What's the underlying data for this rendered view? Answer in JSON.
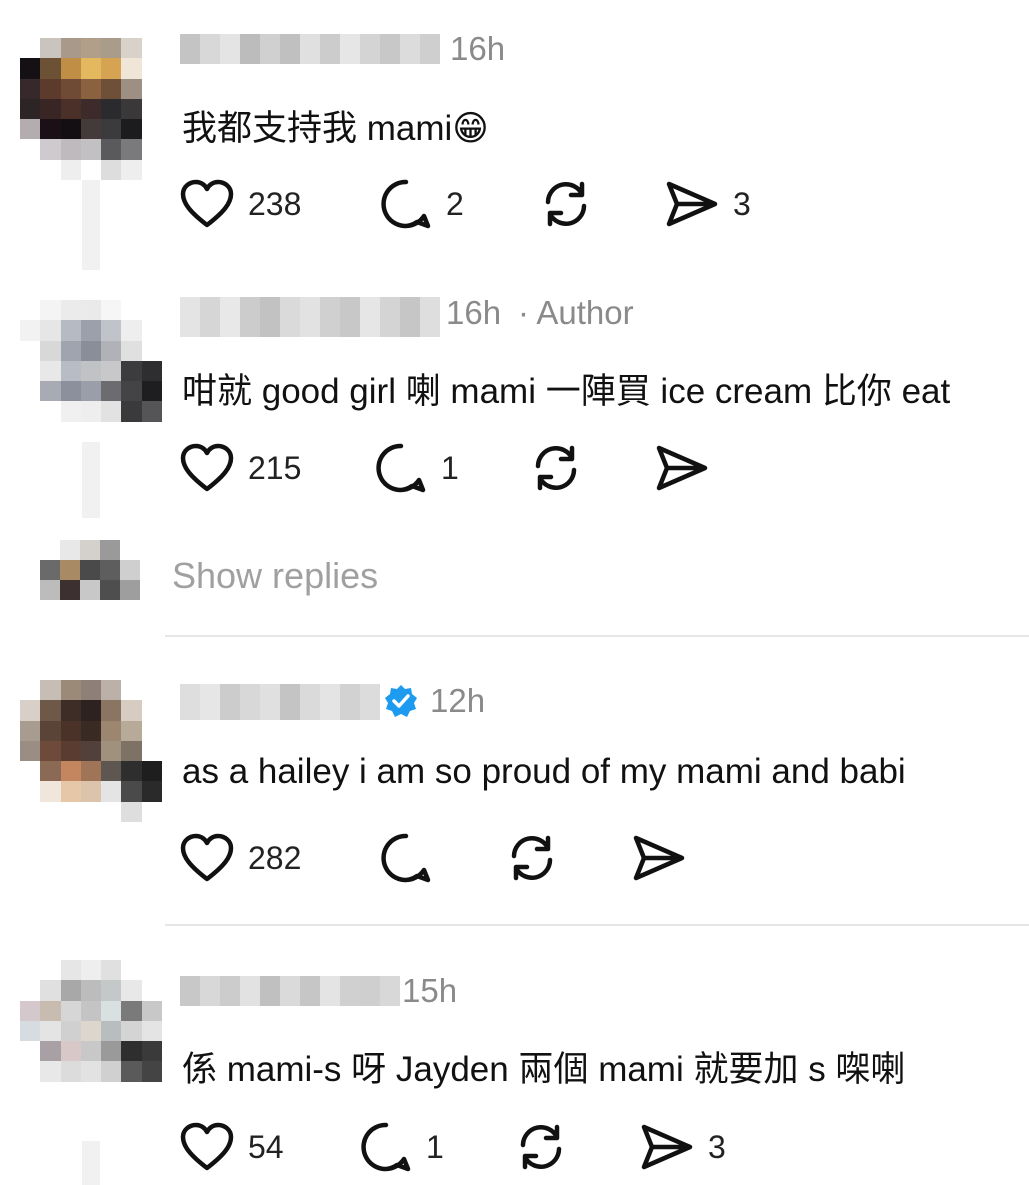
{
  "posts": [
    {
      "time": "16h",
      "author_tag": "",
      "text": "我都支持我 mami😁",
      "likes": "238",
      "replies": "2",
      "shares": "3"
    },
    {
      "time": "16h",
      "author_tag": "· Author",
      "text": "咁就 good girl 喇  mami 一陣買 ice cream 比你 eat",
      "likes": "215",
      "replies": "1",
      "shares": ""
    },
    {
      "time": "12h",
      "author_tag": "",
      "text": "as a hailey i am so proud of my mami and babi",
      "likes": "282",
      "replies": "",
      "shares": ""
    },
    {
      "time": "15h",
      "author_tag": "",
      "text": "係 mami-s 呀 Jayden 兩個 mami 就要加 s 㗎喇",
      "likes": "54",
      "replies": "1",
      "shares": "3"
    }
  ],
  "show_replies_label": "Show replies",
  "colors": {
    "text": "#111111",
    "meta": "#8a8a8a",
    "verified": "#1d9bf0",
    "divider": "#e6e6e6"
  },
  "icons": [
    "heart-icon",
    "comment-icon",
    "repost-icon",
    "share-icon",
    "verified-badge-icon"
  ]
}
